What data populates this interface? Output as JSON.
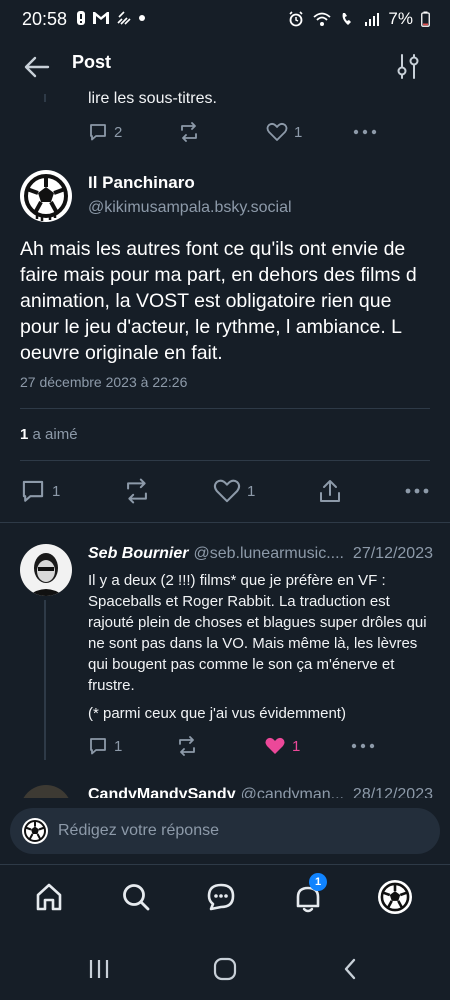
{
  "status_bar": {
    "time": "20:58",
    "battery": "7%"
  },
  "header": {
    "title": "Post"
  },
  "prev_post": {
    "text_tail": "lire les sous-titres.",
    "reply_count": "2",
    "like_count": "1"
  },
  "main_post": {
    "author_name": "Il Panchinaro",
    "handle": "@kikimusampala.bsky.social",
    "text": "Ah mais les autres font ce qu'ils ont envie de faire mais pour ma part, en dehors des films d animation, la VOST est obligatoire rien que pour le jeu d'acteur, le rythme, l ambiance. L oeuvre originale en fait.",
    "timestamp": "27 décembre 2023 à 22:26",
    "likes_bold": "1",
    "likes_label": "a aimé",
    "reply_count": "1",
    "like_count": "1"
  },
  "reply_1": {
    "author_name": "Seb Bournier",
    "handle": "@seb.lunearmusic....",
    "date": "27/12/2023",
    "text": "Il y a deux (2 !!!) films* que je préfère en VF : Spaceballs et Roger Rabbit. La traduction est rajouté plein de choses et blagues super drôles qui ne sont pas dans la VO. Mais même là, les lèvres qui bougent pas comme le son ça m'énerve et frustre.",
    "note": "(* parmi ceux que j'ai vus évidemment)",
    "reply_count": "1",
    "like_count": "1",
    "liked_color": "#ec4899"
  },
  "reply_2": {
    "author_name": "CandyMandySandy",
    "handle": "@candyman...",
    "date": "28/12/2023"
  },
  "compose": {
    "placeholder": "Rédigez votre réponse"
  },
  "bottom_nav": {
    "items": [
      "home-icon",
      "search-icon",
      "chat-icon",
      "bell-icon",
      "profile-avatar"
    ],
    "notification_badge": "1",
    "badge_color": "#1083fe"
  }
}
